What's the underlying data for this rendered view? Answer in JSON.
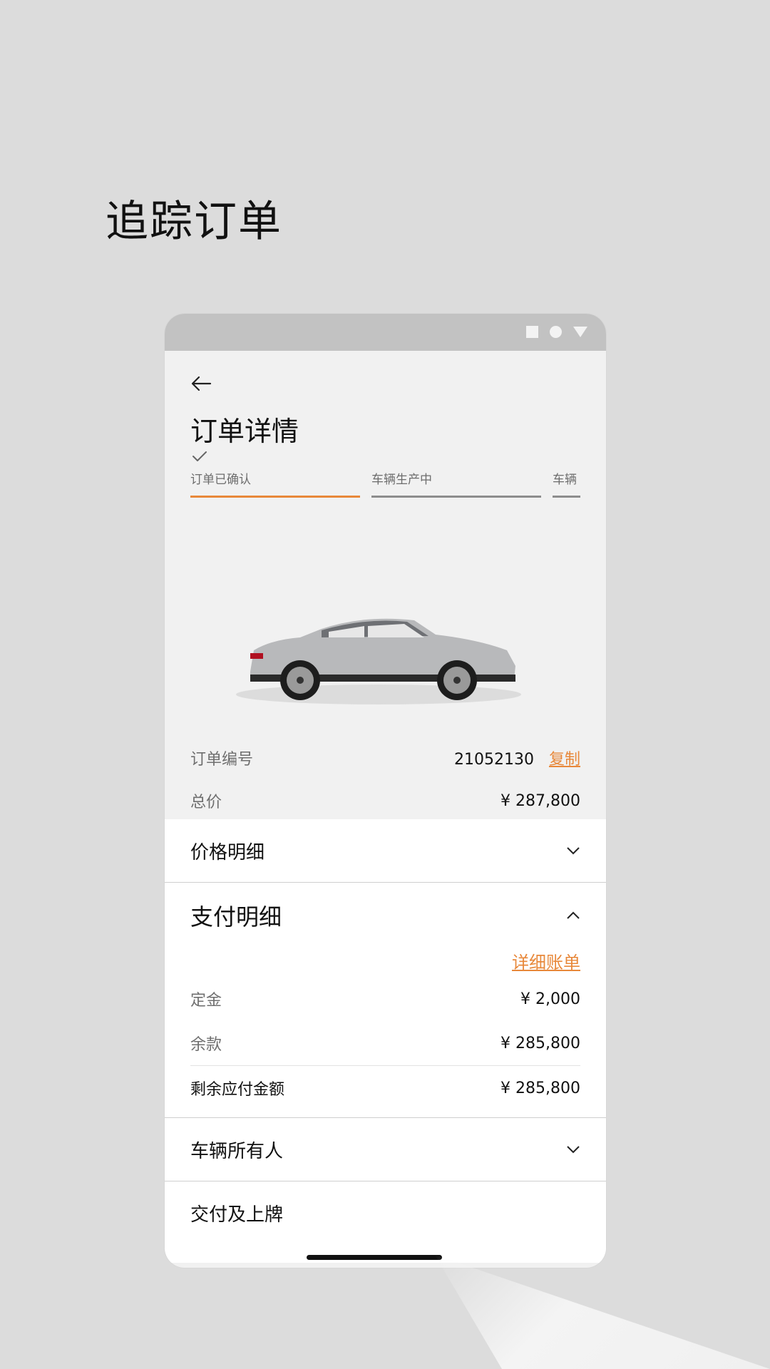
{
  "hero": {
    "title": "追踪订单"
  },
  "status_icons": [
    "square-icon",
    "circle-icon",
    "triangle-icon"
  ],
  "page": {
    "title": "订单详情",
    "steps": [
      {
        "label": "订单已确认",
        "state": "done"
      },
      {
        "label": "车辆生产中",
        "state": "pending"
      },
      {
        "label": "车辆",
        "state": "pending"
      }
    ]
  },
  "order": {
    "number_label": "订单编号",
    "number_value": "21052130",
    "copy_label": "复制",
    "total_label": "总价",
    "total_value": "¥ 287,800"
  },
  "sections": {
    "price_details": "价格明细",
    "payment_details": "支付明细",
    "detailed_bill": "详细账单",
    "deposit_label": "定金",
    "deposit_value": "¥ 2,000",
    "balance_label": "余款",
    "balance_value": "¥ 285,800",
    "remaining_label": "剩余应付金额",
    "remaining_value": "¥ 285,800",
    "vehicle_owner": "车辆所有人",
    "delivery": "交付及上牌"
  },
  "colors": {
    "accent": "#e8883a",
    "background": "#dcdcdc",
    "card": "#f1f1f1"
  }
}
